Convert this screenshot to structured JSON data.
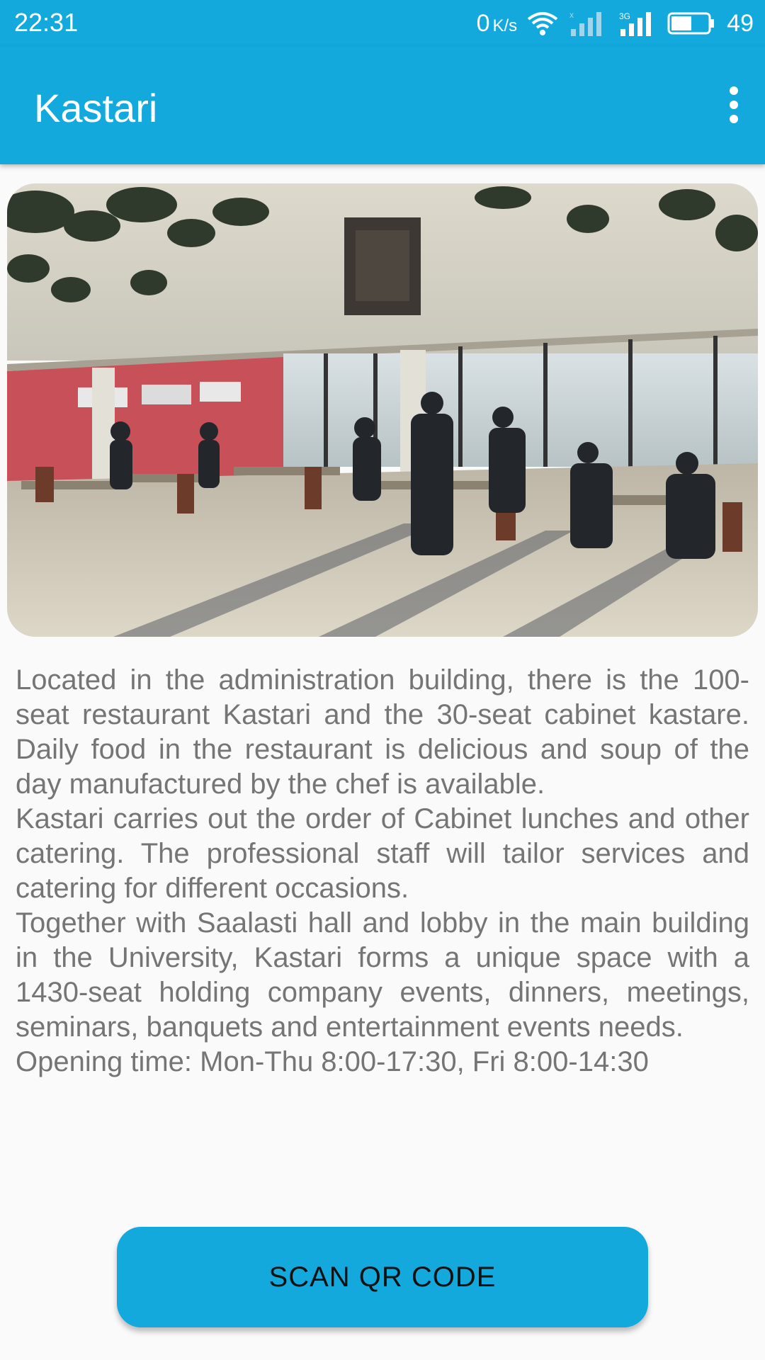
{
  "status_bar": {
    "time": "22:31",
    "net_speed_value": "0",
    "net_speed_unit": "K/s",
    "network_type": "3G",
    "battery_level": "49",
    "icons": [
      "wifi-icon",
      "signal-icon",
      "signal-3g-icon",
      "battery-icon"
    ]
  },
  "app_bar": {
    "title": "Kastari",
    "overflow_icon": "more-vert-icon"
  },
  "content": {
    "paragraphs": [
      "Located in the administration building, there is the 100-seat restaurant Kastari and the 30-seat cabinet kastare. Daily food in the restaurant is delicious and soup of the day manufactured by the chef is available.",
      "Kastari carries out the order of Cabinet lunches and other catering. The professional staff will tailor services and catering for different occasions.",
      "Together with Saalasti hall and lobby in the main building in the University, Kastari forms a unique space with a 1430-seat holding company events, dinners, meetings, seminars, banquets and entertainment events needs.",
      "Opening time: Mon-Thu 8:00-17:30, Fri 8:00-14:30"
    ]
  },
  "actions": {
    "scan_label": "SCAN QR CODE"
  },
  "colors": {
    "primary": "#13a9dd",
    "text": "#757575",
    "background": "#fafafa"
  }
}
